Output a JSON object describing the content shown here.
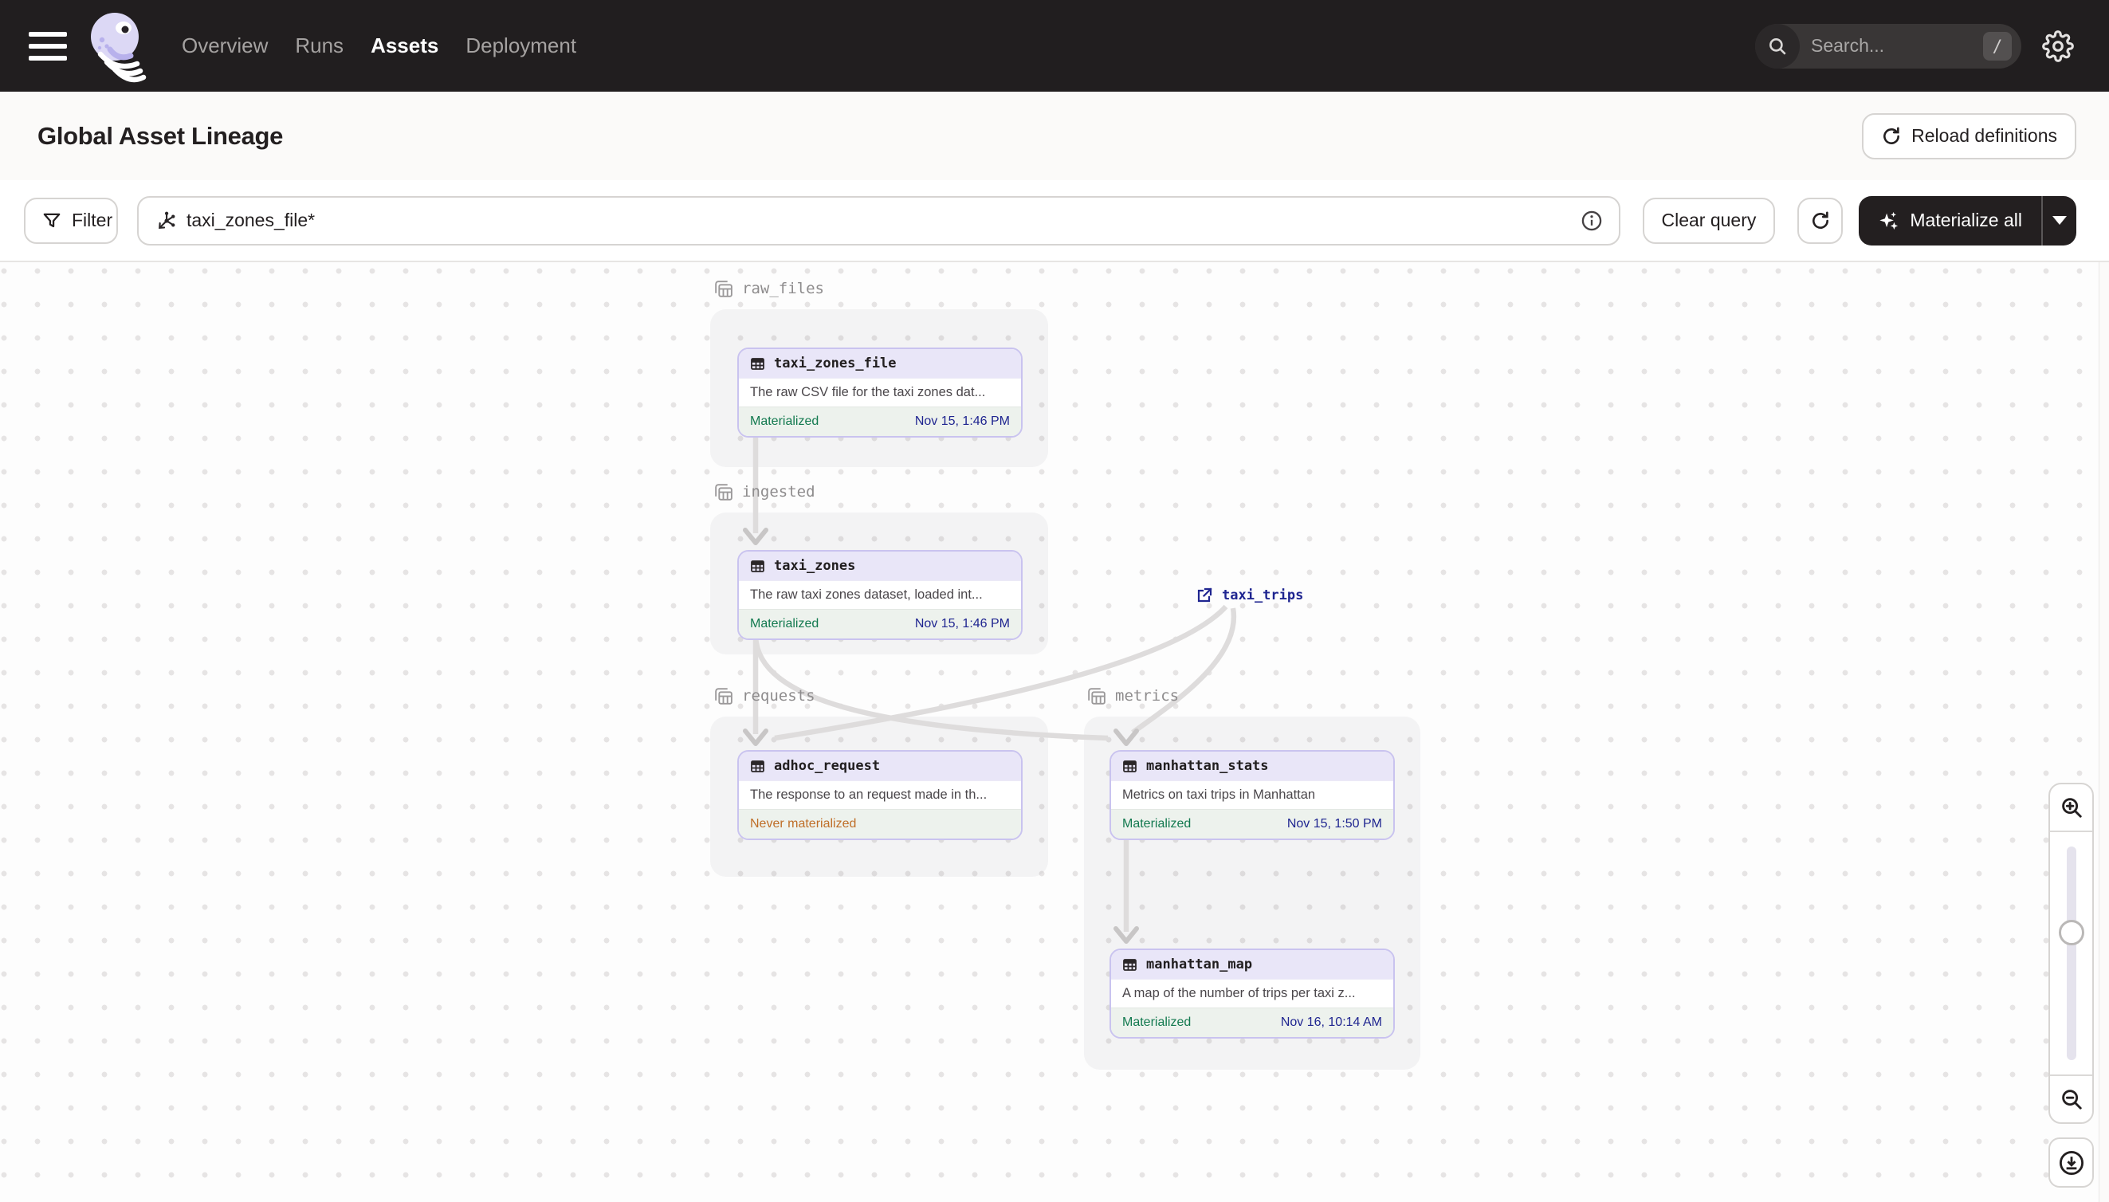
{
  "navbar": {
    "items": [
      {
        "label": "Overview",
        "active": false
      },
      {
        "label": "Runs",
        "active": false
      },
      {
        "label": "Assets",
        "active": true
      },
      {
        "label": "Deployment",
        "active": false
      }
    ],
    "search_placeholder": "Search...",
    "search_shortcut": "/"
  },
  "header": {
    "title": "Global Asset Lineage",
    "reload_label": "Reload definitions"
  },
  "toolbar": {
    "filter_label": "Filter",
    "query_value": "taxi_zones_file*",
    "clear_label": "Clear query",
    "materialize_label": "Materialize all"
  },
  "graph": {
    "groups": [
      {
        "name": "raw_files"
      },
      {
        "name": "ingested"
      },
      {
        "name": "requests"
      },
      {
        "name": "metrics"
      }
    ],
    "nodes": [
      {
        "name": "taxi_zones_file",
        "description": "The raw CSV file for the taxi zones dat...",
        "status": "Materialized",
        "timestamp": "Nov 15, 1:46 PM"
      },
      {
        "name": "taxi_zones",
        "description": "The raw taxi zones dataset, loaded int...",
        "status": "Materialized",
        "timestamp": "Nov 15, 1:46 PM"
      },
      {
        "name": "adhoc_request",
        "description": "The response to an request made in th...",
        "status": "Never materialized",
        "timestamp": ""
      },
      {
        "name": "manhattan_stats",
        "description": "Metrics on taxi trips in Manhattan",
        "status": "Materialized",
        "timestamp": "Nov 15, 1:50 PM"
      },
      {
        "name": "manhattan_map",
        "description": "A map of the number of trips per taxi z...",
        "status": "Materialized",
        "timestamp": "Nov 16, 10:14 AM"
      }
    ],
    "external_assets": [
      {
        "name": "taxi_trips"
      }
    ]
  },
  "icons": {
    "navbar_left": [
      "hamburger-menu",
      "dagster-logo"
    ],
    "navbar_right": [
      "search-magnifier",
      "slash-key",
      "settings-gear"
    ],
    "toolbar": [
      "funnel-filter",
      "asset-selection-graph",
      "info-circle",
      "refresh-arrow",
      "sparkle"
    ],
    "graph": [
      "group-layered-table",
      "table-grid",
      "external-link"
    ],
    "canvas_controls": [
      "zoom-in-magnifier",
      "zoom-out-magnifier",
      "download-circle-arrow"
    ]
  },
  "colors": {
    "navbar_bg": "#211e1f",
    "node_accent_border": "#c9c3ef",
    "node_header_bg": "#e9e6f8",
    "materialized_green": "#12794f",
    "never_materialized_orange": "#bf6e28",
    "timestamp_navy": "#1f2590",
    "dark_button": "#231f20"
  }
}
